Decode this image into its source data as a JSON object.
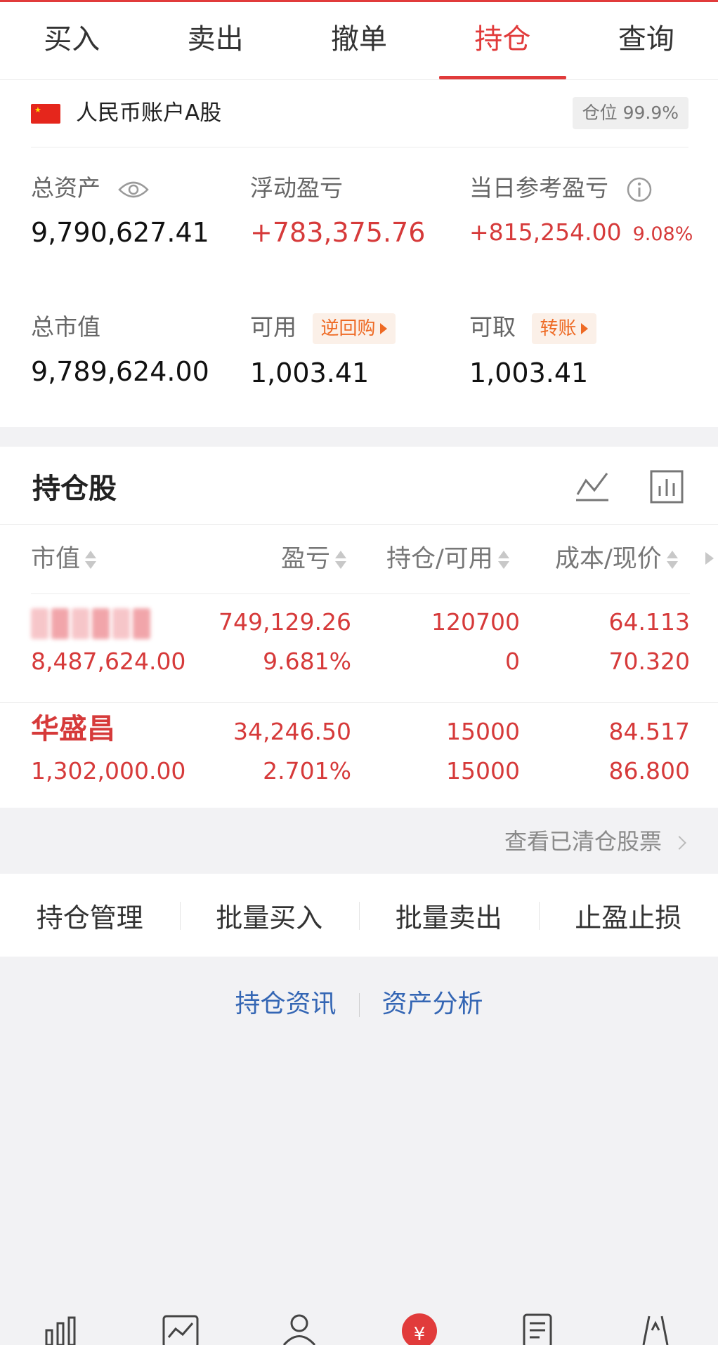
{
  "tabs": [
    {
      "label": "买入"
    },
    {
      "label": "卖出"
    },
    {
      "label": "撤单"
    },
    {
      "label": "持仓",
      "active": true
    },
    {
      "label": "查询"
    }
  ],
  "account": {
    "name": "人民币账户A股",
    "position_ratio": "仓位 99.9%",
    "metrics": {
      "total_assets": {
        "label": "总资产",
        "value": "9,790,627.41"
      },
      "floating_pl": {
        "label": "浮动盈亏",
        "value": "+783,375.76"
      },
      "daily_pl": {
        "label": "当日参考盈亏",
        "value": "+815,254.00",
        "pct": "9.08%"
      },
      "market_value": {
        "label": "总市值",
        "value": "9,789,624.00"
      },
      "available": {
        "label": "可用",
        "value": "1,003.41",
        "link": "逆回购"
      },
      "withdrawable": {
        "label": "可取",
        "value": "1,003.41",
        "link": "转账"
      }
    }
  },
  "holdings": {
    "title": "持仓股",
    "columns": [
      "市值",
      "盈亏",
      "持仓/可用",
      "成本/现价"
    ],
    "rows": [
      {
        "name": "",
        "market_value": "8,487,624.00",
        "pl": "749,129.26",
        "pl_pct": "9.681%",
        "position": "120700",
        "available": "0",
        "cost": "64.113",
        "price": "70.320"
      },
      {
        "name": "华盛昌",
        "market_value": "1,302,000.00",
        "pl": "34,246.50",
        "pl_pct": "2.701%",
        "position": "15000",
        "available": "15000",
        "cost": "84.517",
        "price": "86.800"
      }
    ]
  },
  "cleared_link": "查看已清仓股票",
  "actions": [
    "持仓管理",
    "批量买入",
    "批量卖出",
    "止盈止损"
  ],
  "links": [
    "持仓资讯",
    "资产分析"
  ],
  "colors": {
    "accent": "#e13b3b",
    "link": "#3466b4",
    "orange": "#ee6a24"
  }
}
